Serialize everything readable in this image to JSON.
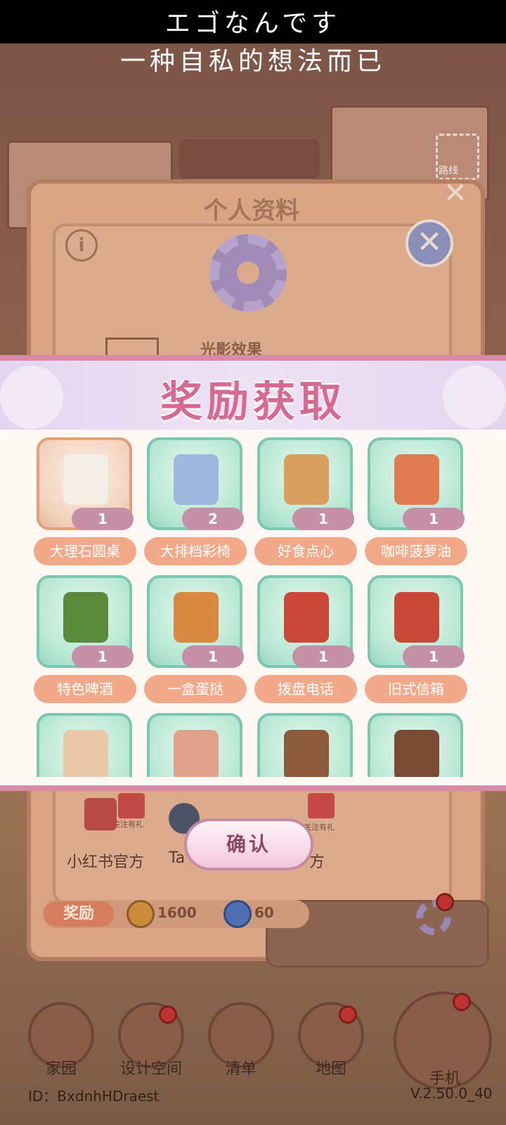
{
  "subtitles": {
    "line1": "エゴなんです",
    "line2": "一种自私的想法而已"
  },
  "background": {
    "scan_label": "路线",
    "profile_panel": {
      "title": "个人资料",
      "light_effect_label": "光影效果",
      "social": [
        {
          "label": "小红书官方",
          "tag": "关注有礼"
        },
        {
          "label": "Ta",
          "tag": ""
        },
        {
          "label": "方",
          "tag": "关注有礼"
        }
      ],
      "reward_label": "奖励",
      "coin_value": "1600",
      "gem_value": "60"
    },
    "nav": [
      {
        "label": "家园",
        "icon": "home-icon"
      },
      {
        "label": "设计空间",
        "icon": "design-icon"
      },
      {
        "label": "清单",
        "icon": "list-icon"
      },
      {
        "label": "地图",
        "icon": "map-pin-icon"
      },
      {
        "label": "手机",
        "icon": "phone-icon"
      }
    ],
    "user_id": "ID：BxdnhHDraest",
    "version": "V.2.50.0_40"
  },
  "reward_dialog": {
    "title": "奖励获取",
    "items": [
      {
        "name": "大理石圆桌",
        "qty": "1",
        "icon": "marble-table-icon",
        "tile": "orange"
      },
      {
        "name": "大排档彩椅",
        "qty": "2",
        "icon": "plastic-chair-icon",
        "tile": "green"
      },
      {
        "name": "好食点心",
        "qty": "1",
        "icon": "dim-sum-icon",
        "tile": "green"
      },
      {
        "name": "咖啡菠萝油",
        "qty": "1",
        "icon": "coffee-bun-icon",
        "tile": "green"
      },
      {
        "name": "特色啤酒",
        "qty": "1",
        "icon": "beer-icon",
        "tile": "green"
      },
      {
        "name": "一盒蛋挞",
        "qty": "1",
        "icon": "egg-tart-box-icon",
        "tile": "green"
      },
      {
        "name": "拨盘电话",
        "qty": "1",
        "icon": "rotary-phone-icon",
        "tile": "green"
      },
      {
        "name": "旧式信箱",
        "qty": "1",
        "icon": "mailbox-icon",
        "tile": "green"
      },
      {
        "name": "",
        "qty": "",
        "icon": "wooden-door-icon",
        "tile": "green"
      },
      {
        "name": "",
        "qty": "",
        "icon": "snail-icon",
        "tile": "green"
      },
      {
        "name": "",
        "qty": "",
        "icon": "tv-cabinet-icon",
        "tile": "green"
      },
      {
        "name": "",
        "qty": "",
        "icon": "arched-door-icon",
        "tile": "green"
      }
    ],
    "confirm_label": "确认"
  },
  "colors": {
    "title_pink": "#d56a92",
    "name_pill": "#f2a98a",
    "qty_pill": "#c58fa6",
    "tile_green_border": "#7dc6b0"
  }
}
